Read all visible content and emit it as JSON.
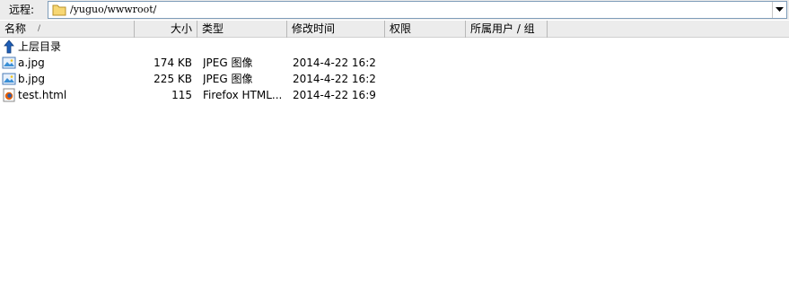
{
  "pathbar": {
    "label": "远程:",
    "path": "/yuguo/wwwroot/"
  },
  "columns": {
    "name": "名称",
    "size": "大小",
    "type": "类型",
    "modified": "修改时间",
    "permissions": "权限",
    "owner": "所属用户 / 组",
    "sort_indicator": "/"
  },
  "parent_row": {
    "label": "上层目录",
    "icon": "up-arrow-icon"
  },
  "files": [
    {
      "name": "a.jpg",
      "size": "174 KB",
      "type": "JPEG 图像",
      "modified": "2014-4-22 16:2",
      "icon": "image-file-icon"
    },
    {
      "name": "b.jpg",
      "size": "225 KB",
      "type": "JPEG 图像",
      "modified": "2014-4-22 16:2",
      "icon": "image-file-icon"
    },
    {
      "name": "test.html",
      "size": "115",
      "type": "Firefox HTML...",
      "modified": "2014-4-22 16:9",
      "icon": "firefox-html-icon"
    }
  ],
  "colors": {
    "folder": "#f2c94c",
    "up_arrow": "#1e5fb8",
    "header_bg": "#ececec"
  }
}
